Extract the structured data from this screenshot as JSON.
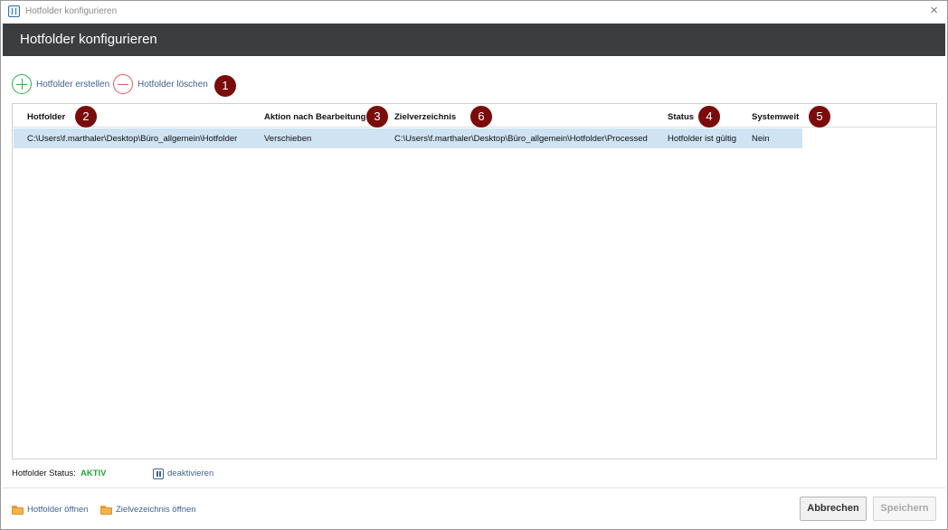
{
  "window": {
    "title": "Hotfolder konfigurieren",
    "icon": "grid-app-icon",
    "close_icon": "close-icon"
  },
  "header": {
    "title": "Hotfolder konfigurieren"
  },
  "toolbar": {
    "create_label": "Hotfolder erstellen",
    "create_icon": "plus-circle-icon",
    "delete_label": "Hotfolder löschen",
    "delete_icon": "minus-circle-icon"
  },
  "badges": [
    "1",
    "2",
    "3",
    "6",
    "4",
    "5"
  ],
  "table": {
    "columns": [
      "Hotfolder",
      "Aktion nach Bearbeitung",
      "Zielverzeichnis",
      "Status",
      "Systemweit"
    ],
    "rows": [
      [
        "C:\\Users\\f.marthaler\\Desktop\\Büro_allgemein\\Hotfolder",
        "Verschieben",
        "C:\\Users\\f.marthaler\\Desktop\\Büro_allgemein\\Hotfolder\\Processed",
        "Hotfolder ist gültig",
        "Nein"
      ]
    ]
  },
  "status": {
    "label": "Hotfolder Status:",
    "value": "AKTIV",
    "toggle_label": "deaktivieren",
    "toggle_icon": "pause-icon"
  },
  "footer": {
    "open_hotfolder_label": "Hotfolder öffnen",
    "open_target_label": "Zielvezeichnis öffnen",
    "folder_icon": "folder-icon",
    "cancel_label": "Abbrechen",
    "save_label": "Speichern"
  },
  "colors": {
    "header_bg": "#3c3d3f",
    "selected_row": "#cfe3f3",
    "status_active": "#22a836",
    "badge": "#7a0c0c",
    "link": "#40628f"
  }
}
